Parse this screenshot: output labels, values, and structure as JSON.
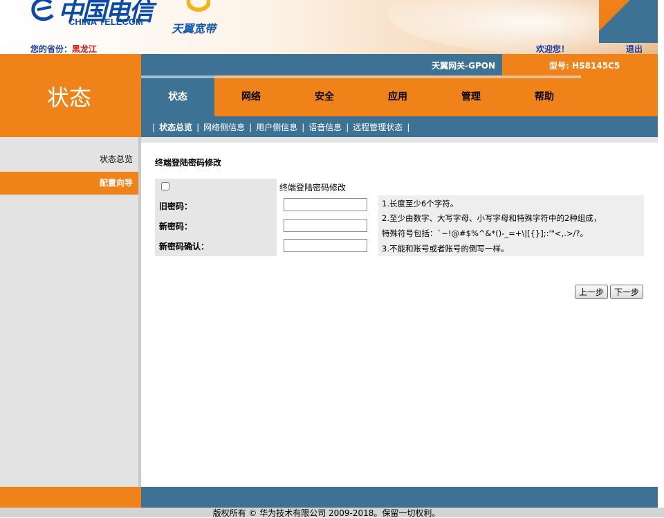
{
  "header": {
    "logo_cn": "中国电信",
    "logo_en": "CHINA TELECOM",
    "brand": "天翼宽带",
    "province_label": "您的省份：",
    "province_value": "黑龙江",
    "welcome": "欢迎您！",
    "logout": "退出"
  },
  "gateway": {
    "name": "天翼网关-GPON",
    "model": "型号: HS8145C5"
  },
  "section_title": "状态",
  "tabs": [
    {
      "label": "状态",
      "active": true
    },
    {
      "label": "网络",
      "active": false
    },
    {
      "label": "安全",
      "active": false
    },
    {
      "label": "应用",
      "active": false
    },
    {
      "label": "管理",
      "active": false
    },
    {
      "label": "帮助",
      "active": false
    }
  ],
  "subnav": [
    {
      "label": "状态总览",
      "active": true
    },
    {
      "label": "网络侧信息",
      "active": false
    },
    {
      "label": "用户侧信息",
      "active": false
    },
    {
      "label": "语音信息",
      "active": false
    },
    {
      "label": "远程管理状态",
      "active": false
    }
  ],
  "sidebar": {
    "items": [
      {
        "label": "状态总览",
        "active": false
      },
      {
        "label": "配置向导",
        "active": true
      }
    ]
  },
  "form": {
    "heading": "终端登陆密码修改",
    "checkbox_label": "终端登陆密码修改",
    "checkbox_checked": false,
    "old_password_label": "旧密码：",
    "new_password_label": "新密码：",
    "confirm_password_label": "新密码确认：",
    "old_password_value": "",
    "new_password_value": "",
    "confirm_password_value": "",
    "rules": [
      "1.长度至少6个字符。",
      "2.至少由数字、大写字母、小写字母和特殊字符中的2种组成，",
      "特殊符号包括：`~!@#$%^&*()-_=+\\|[{}];:'\"<,.>/?。",
      "3.不能和账号或者账号的倒写一样。"
    ],
    "prev_button": "上一步",
    "next_button": "下一步"
  },
  "footer": {
    "copyright": "版权所有 © 华为技术有限公司 2009-2018。保留一切权利。"
  },
  "colors": {
    "orange": "#ef831a",
    "blue": "#3d7295",
    "sidebar_gray": "#e3e3e3",
    "link_blue": "#1f3ea0",
    "province_red": "#d8171c"
  }
}
